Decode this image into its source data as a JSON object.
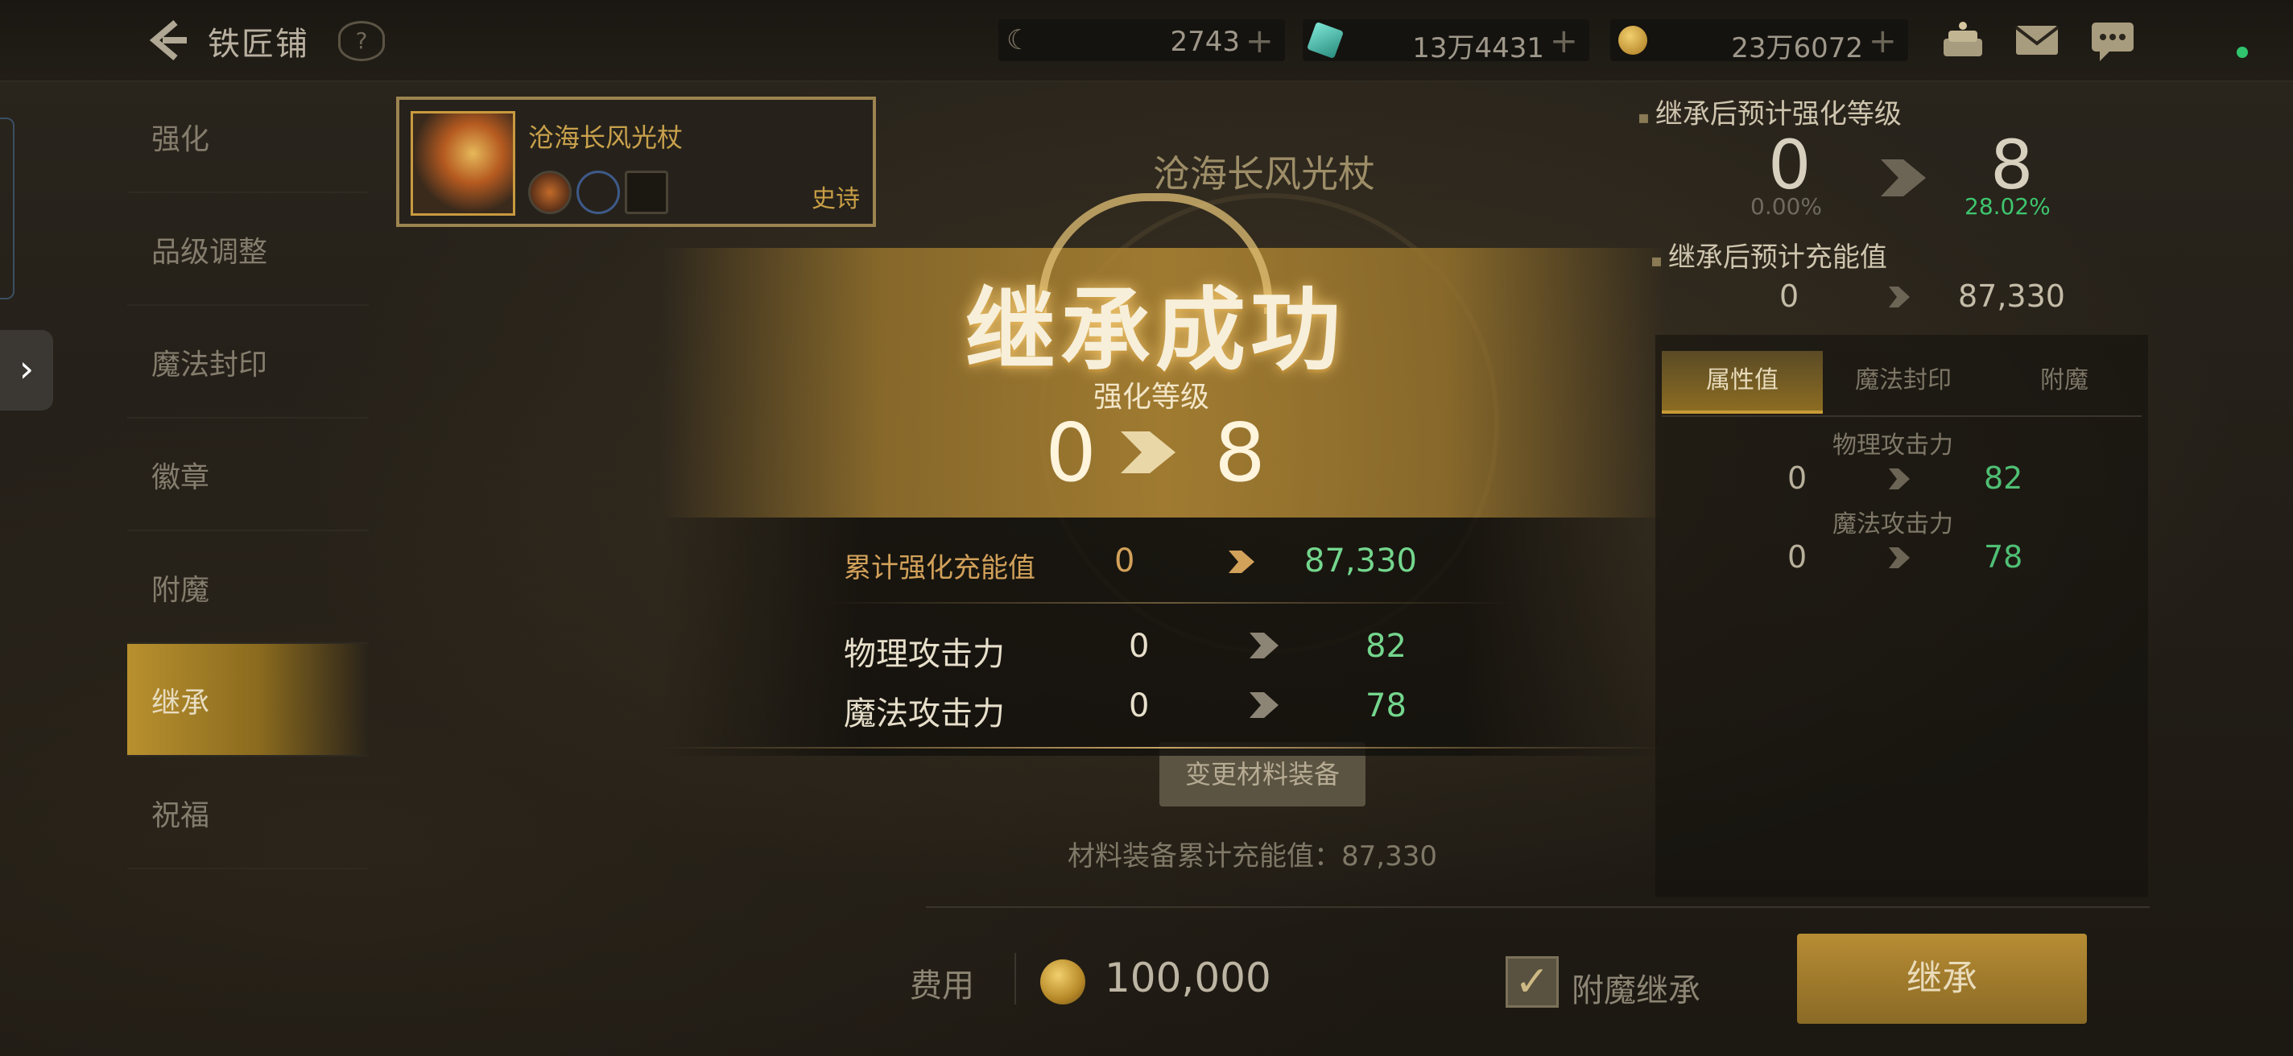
{
  "header": {
    "title": "铁匠铺",
    "currencies": [
      {
        "name": "moon-currency",
        "value": "2743"
      },
      {
        "name": "gem-currency",
        "value": "13万4431"
      },
      {
        "name": "gold-currency",
        "value": "23万6072"
      }
    ]
  },
  "sidebar": {
    "items": [
      {
        "label": "强化"
      },
      {
        "label": "品级调整"
      },
      {
        "label": "魔法封印"
      },
      {
        "label": "徽章"
      },
      {
        "label": "附魔"
      },
      {
        "label": "继承"
      },
      {
        "label": "祝福"
      }
    ],
    "active_index": 5
  },
  "item": {
    "name": "沧海长风光杖",
    "grade": "史诗"
  },
  "center": {
    "title": "沧海长风光杖",
    "change_material_button": "变更材料装备",
    "material_total_label": "材料装备累计充能值：",
    "material_total_value": "87,330"
  },
  "success": {
    "title": "继承成功",
    "enhance_label": "强化等级",
    "enhance_from": "0",
    "enhance_to": "8",
    "rows": [
      {
        "label": "累计强化充能值",
        "from": "0",
        "to": "87,330"
      },
      {
        "label": "物理攻击力",
        "from": "0",
        "to": "82"
      },
      {
        "label": "魔法攻击力",
        "from": "0",
        "to": "78"
      }
    ]
  },
  "right_panel": {
    "level_heading": "继承后预计强化等级",
    "level_from": "0",
    "level_from_pct": "0.00%",
    "level_to": "8",
    "level_to_pct": "28.02%",
    "charge_heading": "继承后预计充能值",
    "charge_from": "0",
    "charge_to": "87,330",
    "tabs": [
      "属性值",
      "魔法封印",
      "附魔"
    ],
    "active_tab": 0,
    "stats": [
      {
        "label": "物理攻击力",
        "from": "0",
        "to": "82"
      },
      {
        "label": "魔法攻击力",
        "from": "0",
        "to": "78"
      }
    ]
  },
  "footer": {
    "cost_label": "费用",
    "cost_value": "100,000",
    "checkbox_label": "附魔继承",
    "checkbox_checked": true,
    "inherit_button": "继承"
  },
  "colors": {
    "accent_gold": "#b78c34",
    "increase_green": "#74d68d",
    "text_light": "#e7dfcb"
  }
}
